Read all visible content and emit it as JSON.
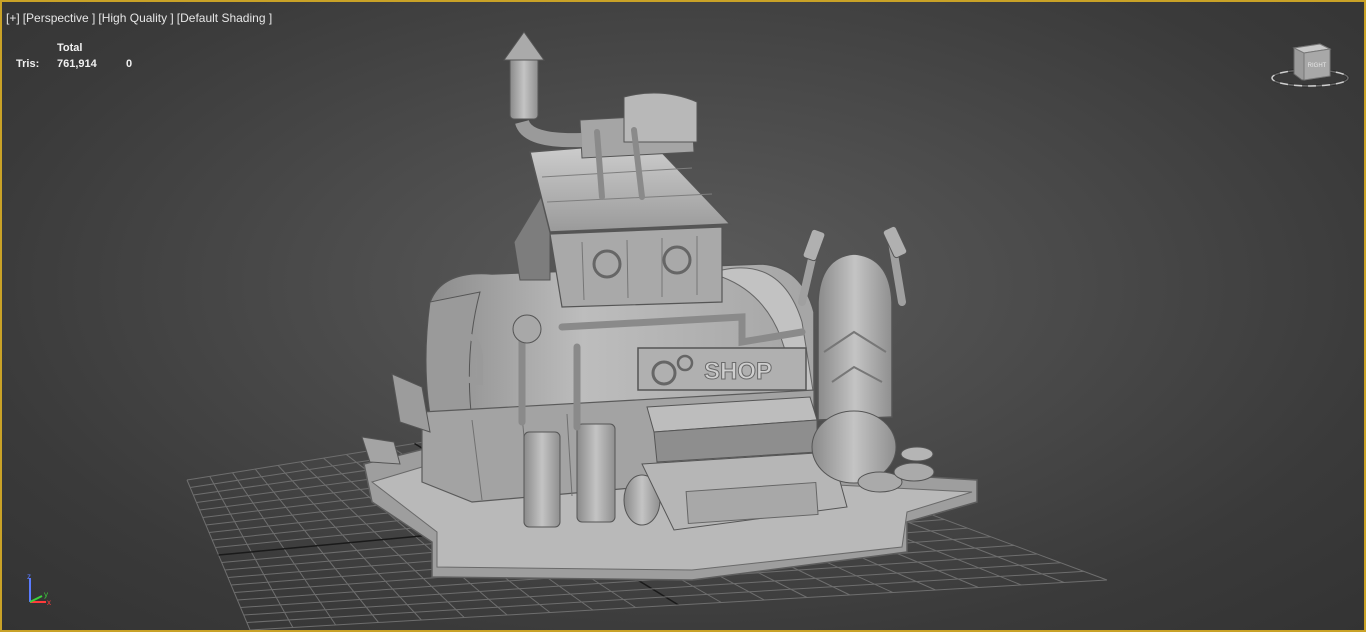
{
  "viewport": {
    "labels": {
      "plus": "[+]",
      "view": "[Perspective ]",
      "quality": "[High Quality ]",
      "shading": "[Default Shading ]"
    },
    "stats": {
      "header": "Total",
      "tris_label": "Tris:",
      "tris_total": "761,914",
      "tris_selected": "0"
    },
    "model": {
      "sign_text": "SHOP"
    },
    "viewcube": {
      "face_label": "RIGHT"
    },
    "axis": {
      "x": "x",
      "y": "y",
      "z": "z"
    },
    "colors": {
      "border": "#c9a227",
      "grid": "#6e6e6e",
      "grid_axis": "#1a1a1a",
      "model": "#b5b5b5",
      "axis_x": "#ff3b3b",
      "axis_y": "#3bd13b",
      "axis_z": "#5a7bff"
    }
  }
}
